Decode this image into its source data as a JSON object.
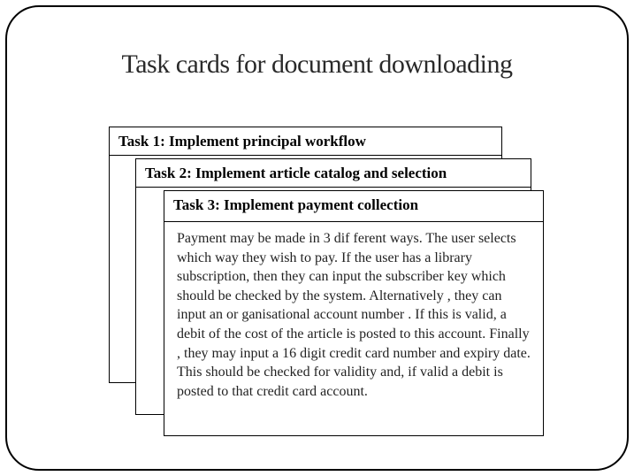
{
  "title": "Task cards for document downloading",
  "cards": {
    "card1": {
      "heading": "Task 1: Implement principal workflow"
    },
    "card2": {
      "heading": "Task 2: Implement article catalog and selection"
    },
    "card3": {
      "heading": "Task 3: Implement payment collection",
      "body": "Payment may be made in 3 dif ferent ways. The user selects which way they wish to pay. If the user has a library subscription, then they can input the subscriber key which should be checked by the system. Alternatively , they can input an or ganisational account number . If this is valid, a debit of the cost of the article is posted to this account. Finally , they may input a 16 digit credit card number and expiry date. This should be checked for validity and, if valid a debit is posted to that credit card account."
    }
  }
}
